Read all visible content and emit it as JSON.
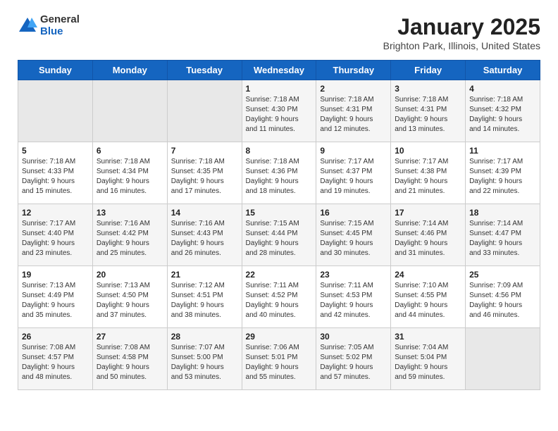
{
  "logo": {
    "general": "General",
    "blue": "Blue"
  },
  "title": "January 2025",
  "subtitle": "Brighton Park, Illinois, United States",
  "days_of_week": [
    "Sunday",
    "Monday",
    "Tuesday",
    "Wednesday",
    "Thursday",
    "Friday",
    "Saturday"
  ],
  "weeks": [
    [
      {
        "day": "",
        "info": ""
      },
      {
        "day": "",
        "info": ""
      },
      {
        "day": "",
        "info": ""
      },
      {
        "day": "1",
        "info": "Sunrise: 7:18 AM\nSunset: 4:30 PM\nDaylight: 9 hours\nand 11 minutes."
      },
      {
        "day": "2",
        "info": "Sunrise: 7:18 AM\nSunset: 4:31 PM\nDaylight: 9 hours\nand 12 minutes."
      },
      {
        "day": "3",
        "info": "Sunrise: 7:18 AM\nSunset: 4:31 PM\nDaylight: 9 hours\nand 13 minutes."
      },
      {
        "day": "4",
        "info": "Sunrise: 7:18 AM\nSunset: 4:32 PM\nDaylight: 9 hours\nand 14 minutes."
      }
    ],
    [
      {
        "day": "5",
        "info": "Sunrise: 7:18 AM\nSunset: 4:33 PM\nDaylight: 9 hours\nand 15 minutes."
      },
      {
        "day": "6",
        "info": "Sunrise: 7:18 AM\nSunset: 4:34 PM\nDaylight: 9 hours\nand 16 minutes."
      },
      {
        "day": "7",
        "info": "Sunrise: 7:18 AM\nSunset: 4:35 PM\nDaylight: 9 hours\nand 17 minutes."
      },
      {
        "day": "8",
        "info": "Sunrise: 7:18 AM\nSunset: 4:36 PM\nDaylight: 9 hours\nand 18 minutes."
      },
      {
        "day": "9",
        "info": "Sunrise: 7:17 AM\nSunset: 4:37 PM\nDaylight: 9 hours\nand 19 minutes."
      },
      {
        "day": "10",
        "info": "Sunrise: 7:17 AM\nSunset: 4:38 PM\nDaylight: 9 hours\nand 21 minutes."
      },
      {
        "day": "11",
        "info": "Sunrise: 7:17 AM\nSunset: 4:39 PM\nDaylight: 9 hours\nand 22 minutes."
      }
    ],
    [
      {
        "day": "12",
        "info": "Sunrise: 7:17 AM\nSunset: 4:40 PM\nDaylight: 9 hours\nand 23 minutes."
      },
      {
        "day": "13",
        "info": "Sunrise: 7:16 AM\nSunset: 4:42 PM\nDaylight: 9 hours\nand 25 minutes."
      },
      {
        "day": "14",
        "info": "Sunrise: 7:16 AM\nSunset: 4:43 PM\nDaylight: 9 hours\nand 26 minutes."
      },
      {
        "day": "15",
        "info": "Sunrise: 7:15 AM\nSunset: 4:44 PM\nDaylight: 9 hours\nand 28 minutes."
      },
      {
        "day": "16",
        "info": "Sunrise: 7:15 AM\nSunset: 4:45 PM\nDaylight: 9 hours\nand 30 minutes."
      },
      {
        "day": "17",
        "info": "Sunrise: 7:14 AM\nSunset: 4:46 PM\nDaylight: 9 hours\nand 31 minutes."
      },
      {
        "day": "18",
        "info": "Sunrise: 7:14 AM\nSunset: 4:47 PM\nDaylight: 9 hours\nand 33 minutes."
      }
    ],
    [
      {
        "day": "19",
        "info": "Sunrise: 7:13 AM\nSunset: 4:49 PM\nDaylight: 9 hours\nand 35 minutes."
      },
      {
        "day": "20",
        "info": "Sunrise: 7:13 AM\nSunset: 4:50 PM\nDaylight: 9 hours\nand 37 minutes."
      },
      {
        "day": "21",
        "info": "Sunrise: 7:12 AM\nSunset: 4:51 PM\nDaylight: 9 hours\nand 38 minutes."
      },
      {
        "day": "22",
        "info": "Sunrise: 7:11 AM\nSunset: 4:52 PM\nDaylight: 9 hours\nand 40 minutes."
      },
      {
        "day": "23",
        "info": "Sunrise: 7:11 AM\nSunset: 4:53 PM\nDaylight: 9 hours\nand 42 minutes."
      },
      {
        "day": "24",
        "info": "Sunrise: 7:10 AM\nSunset: 4:55 PM\nDaylight: 9 hours\nand 44 minutes."
      },
      {
        "day": "25",
        "info": "Sunrise: 7:09 AM\nSunset: 4:56 PM\nDaylight: 9 hours\nand 46 minutes."
      }
    ],
    [
      {
        "day": "26",
        "info": "Sunrise: 7:08 AM\nSunset: 4:57 PM\nDaylight: 9 hours\nand 48 minutes."
      },
      {
        "day": "27",
        "info": "Sunrise: 7:08 AM\nSunset: 4:58 PM\nDaylight: 9 hours\nand 50 minutes."
      },
      {
        "day": "28",
        "info": "Sunrise: 7:07 AM\nSunset: 5:00 PM\nDaylight: 9 hours\nand 53 minutes."
      },
      {
        "day": "29",
        "info": "Sunrise: 7:06 AM\nSunset: 5:01 PM\nDaylight: 9 hours\nand 55 minutes."
      },
      {
        "day": "30",
        "info": "Sunrise: 7:05 AM\nSunset: 5:02 PM\nDaylight: 9 hours\nand 57 minutes."
      },
      {
        "day": "31",
        "info": "Sunrise: 7:04 AM\nSunset: 5:04 PM\nDaylight: 9 hours\nand 59 minutes."
      },
      {
        "day": "",
        "info": ""
      }
    ]
  ]
}
